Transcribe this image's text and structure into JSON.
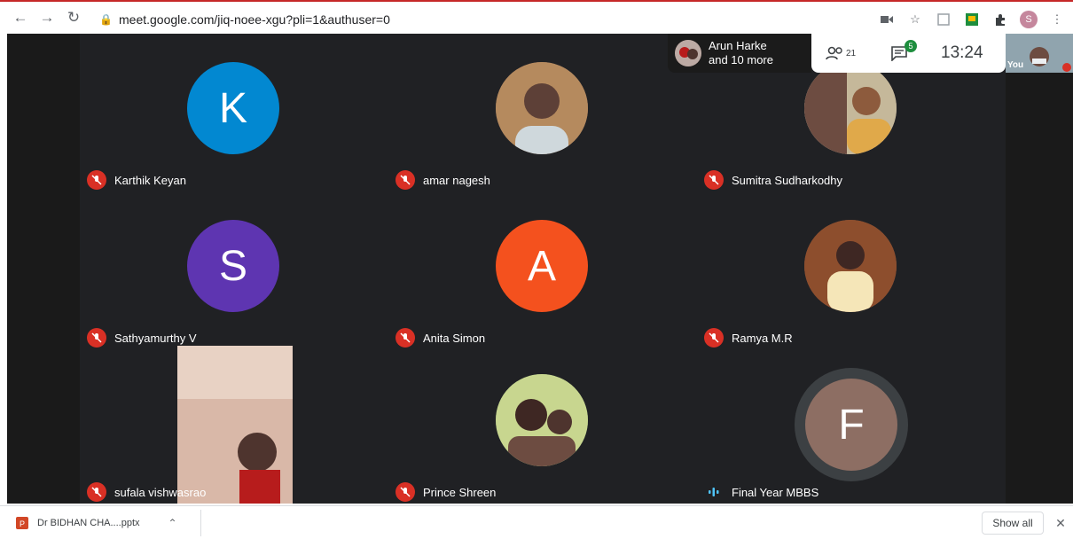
{
  "browser": {
    "url": "meet.google.com/jiq-noee-xgu?pli=1&authuser=0",
    "profile_initial": "S"
  },
  "meet": {
    "presenter_chip": {
      "line1": "Arun Harke",
      "line2": "and 10 more"
    },
    "people_count": "21",
    "chat_count": "5",
    "clock": "13:24",
    "self_label": "You",
    "participants": [
      {
        "name": "Karthik Keyan",
        "initial": "K",
        "color": "#0288d1",
        "mic": "muted"
      },
      {
        "name": "amar nagesh",
        "initial": "",
        "color": "#8d6e63",
        "mic": "muted"
      },
      {
        "name": "Sumitra Sudharkodhy",
        "initial": "",
        "color": "#a1887f",
        "mic": "muted"
      },
      {
        "name": "Sathyamurthy V",
        "initial": "S",
        "color": "#5e35b1",
        "mic": "muted"
      },
      {
        "name": "Anita Simon",
        "initial": "A",
        "color": "#f4511e",
        "mic": "muted"
      },
      {
        "name": "Ramya M.R",
        "initial": "",
        "color": "#795548",
        "mic": "muted"
      },
      {
        "name": "sufala vishwasrao",
        "initial": "",
        "color": "#bcaaa4",
        "mic": "muted"
      },
      {
        "name": "Prince Shreen",
        "initial": "",
        "color": "#6d8f6a",
        "mic": "muted"
      },
      {
        "name": "Final Year MBBS",
        "initial": "F",
        "color": "#8d6e63",
        "mic": "speaking"
      }
    ]
  },
  "downloads": {
    "item_label": "Dr BIDHAN CHA....pptx",
    "show_all": "Show all"
  },
  "colors": {
    "accent_red": "#d93025",
    "stage_bg": "#202124"
  }
}
